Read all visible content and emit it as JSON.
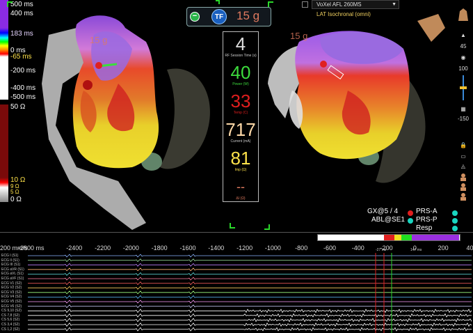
{
  "scale": {
    "lat_labels": [
      "500 ms",
      "400 ms",
      "183 ms",
      "0 ms",
      "-65 ms",
      "-200 ms",
      "-400 ms",
      "-500 ms"
    ],
    "imp_labels": [
      "50 Ω",
      "10 Ω",
      "9 Ω",
      "5 Ω",
      "0 Ω"
    ]
  },
  "header": {
    "tf_label": "TF",
    "force": "15 g",
    "force_left": "15 g",
    "force_right": "15 g",
    "map_select": "VoXel AFL 260MS",
    "map_subtitle": "LAT Isochronal (omni)"
  },
  "rf_panel": {
    "time": {
      "value": "4",
      "label": "RF Session Time (s)",
      "color": "#ffffff"
    },
    "power": {
      "value": "40",
      "label": "Power (W)",
      "color": "#3ddc3d"
    },
    "temp": {
      "value": "33",
      "label": "Temp (C)",
      "color": "#e01e1e"
    },
    "current": {
      "value": "717",
      "label": "Current (mA)",
      "color": "#ffd9a8"
    },
    "imp": {
      "value": "81",
      "label": "Imp (Ω)",
      "color": "#ffe34a"
    },
    "dimp": {
      "value": "--",
      "label": "ΔI (Ω)",
      "color": "#e07a5f"
    }
  },
  "toolbar": {
    "zoom_label": "45",
    "val_100": "100",
    "val_neg150": "-150"
  },
  "legend": {
    "gx": "GX@5 / 4",
    "abl": "ABL@SE1",
    "prs_a": "PRS-A",
    "prs_p": "PRS-P",
    "resp": "Resp",
    "colors": {
      "prs_a": "#e01e1e",
      "prs_p": "#19d6c0",
      "gx": "#e01e1e",
      "abl": "#19d6c0"
    }
  },
  "ecg": {
    "speed": "200 mm/s",
    "ticks": [
      "-2600 ms",
      "-2400",
      "-2200",
      "-2000",
      "-1800",
      "-1600",
      "-1400",
      "-1200",
      "-1000",
      "-800",
      "-600",
      "-400",
      "-200",
      "0",
      "200",
      "400"
    ],
    "strip_labels": [
      "-27 ms",
      "147 ms"
    ],
    "channels": [
      "ECG I (S1)",
      "ECG II (S1)",
      "ECG III (S1)",
      "ECG aVR (S1)",
      "ECG aVL (S1)",
      "ECG aVF (S1)",
      "ECG V1 (S2)",
      "ECG V2 (S2)",
      "ECG V3 (S2)",
      "ECG V4 (S2)",
      "ECG V5 (S2)",
      "ECG V6 (S2)",
      "CS 9,10 (S2)",
      "CS 7,8 (S2)",
      "CS 5,6 (S2)",
      "CS 3,4 (S2)",
      "CS 1,2 (S2)"
    ]
  }
}
